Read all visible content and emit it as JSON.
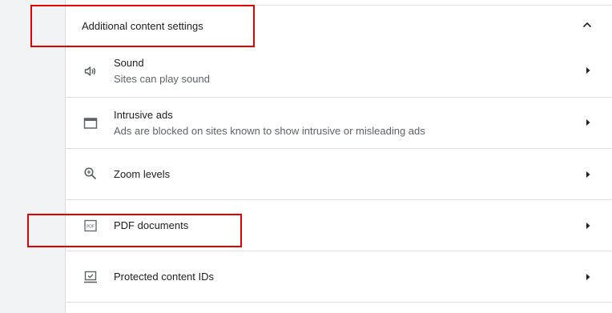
{
  "section": {
    "title": "Additional content settings",
    "expanded": true
  },
  "rows": [
    {
      "label": "Sound",
      "sublabel": "Sites can play sound",
      "icon": "speaker-icon"
    },
    {
      "label": "Intrusive ads",
      "sublabel": "Ads are blocked on sites known to show intrusive or misleading ads",
      "icon": "browser-window-icon"
    },
    {
      "label": "Zoom levels",
      "sublabel": "",
      "icon": "zoom-in-icon"
    },
    {
      "label": "PDF documents",
      "sublabel": "",
      "icon": "pdf-document-icon",
      "icon_text": "PDF"
    },
    {
      "label": "Protected content IDs",
      "sublabel": "",
      "icon": "protected-content-icon"
    }
  ],
  "colors": {
    "highlight": "#e00000",
    "text_primary": "#202124",
    "text_secondary": "#5f6368",
    "icon": "#5f6368",
    "divider": "#e3e3e3"
  }
}
